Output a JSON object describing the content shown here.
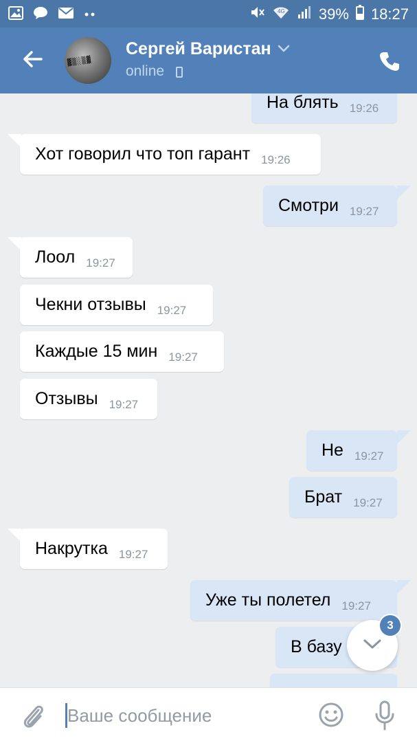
{
  "status_bar": {
    "left_icons": [
      "image-icon",
      "chat-bubble-icon",
      "mail-icon",
      "more-dots-icon"
    ],
    "right_icons": [
      "mute-icon",
      "wifi-icon",
      "signal-icon"
    ],
    "battery": "39%",
    "time": "18:27"
  },
  "header": {
    "contact_name": "Сергей Варистан",
    "status": "online",
    "colors": {
      "bar": "#5181b8",
      "status_bar": "#4a76a8"
    }
  },
  "messages": [
    {
      "dir": "out",
      "text": "На блять",
      "time": "19:26"
    },
    {
      "dir": "in",
      "text": "Хот говорил что топ гарант",
      "time": "19:26"
    },
    {
      "dir": "out",
      "text": "Смотри",
      "time": "19:27"
    },
    {
      "dir": "in",
      "text": "Лоол",
      "time": "19:27"
    },
    {
      "dir": "in",
      "text": "Чекни отзывы",
      "time": "19:27"
    },
    {
      "dir": "in",
      "text": "Каждые 15 мин",
      "time": "19:27"
    },
    {
      "dir": "in",
      "text": "Отзывы",
      "time": "19:27"
    },
    {
      "dir": "out",
      "text": "Не",
      "time": "19:27"
    },
    {
      "dir": "out",
      "text": "Брат",
      "time": "19:27"
    },
    {
      "dir": "in",
      "text": "Накрутка",
      "time": "19:27"
    },
    {
      "dir": "out",
      "text": "Уже ты полетел",
      "time": "19:27"
    },
    {
      "dir": "out",
      "text": "В базу",
      "time": ""
    }
  ],
  "scroll_button": {
    "unread_count": "3"
  },
  "composer": {
    "placeholder": "Ваше сообщение"
  }
}
